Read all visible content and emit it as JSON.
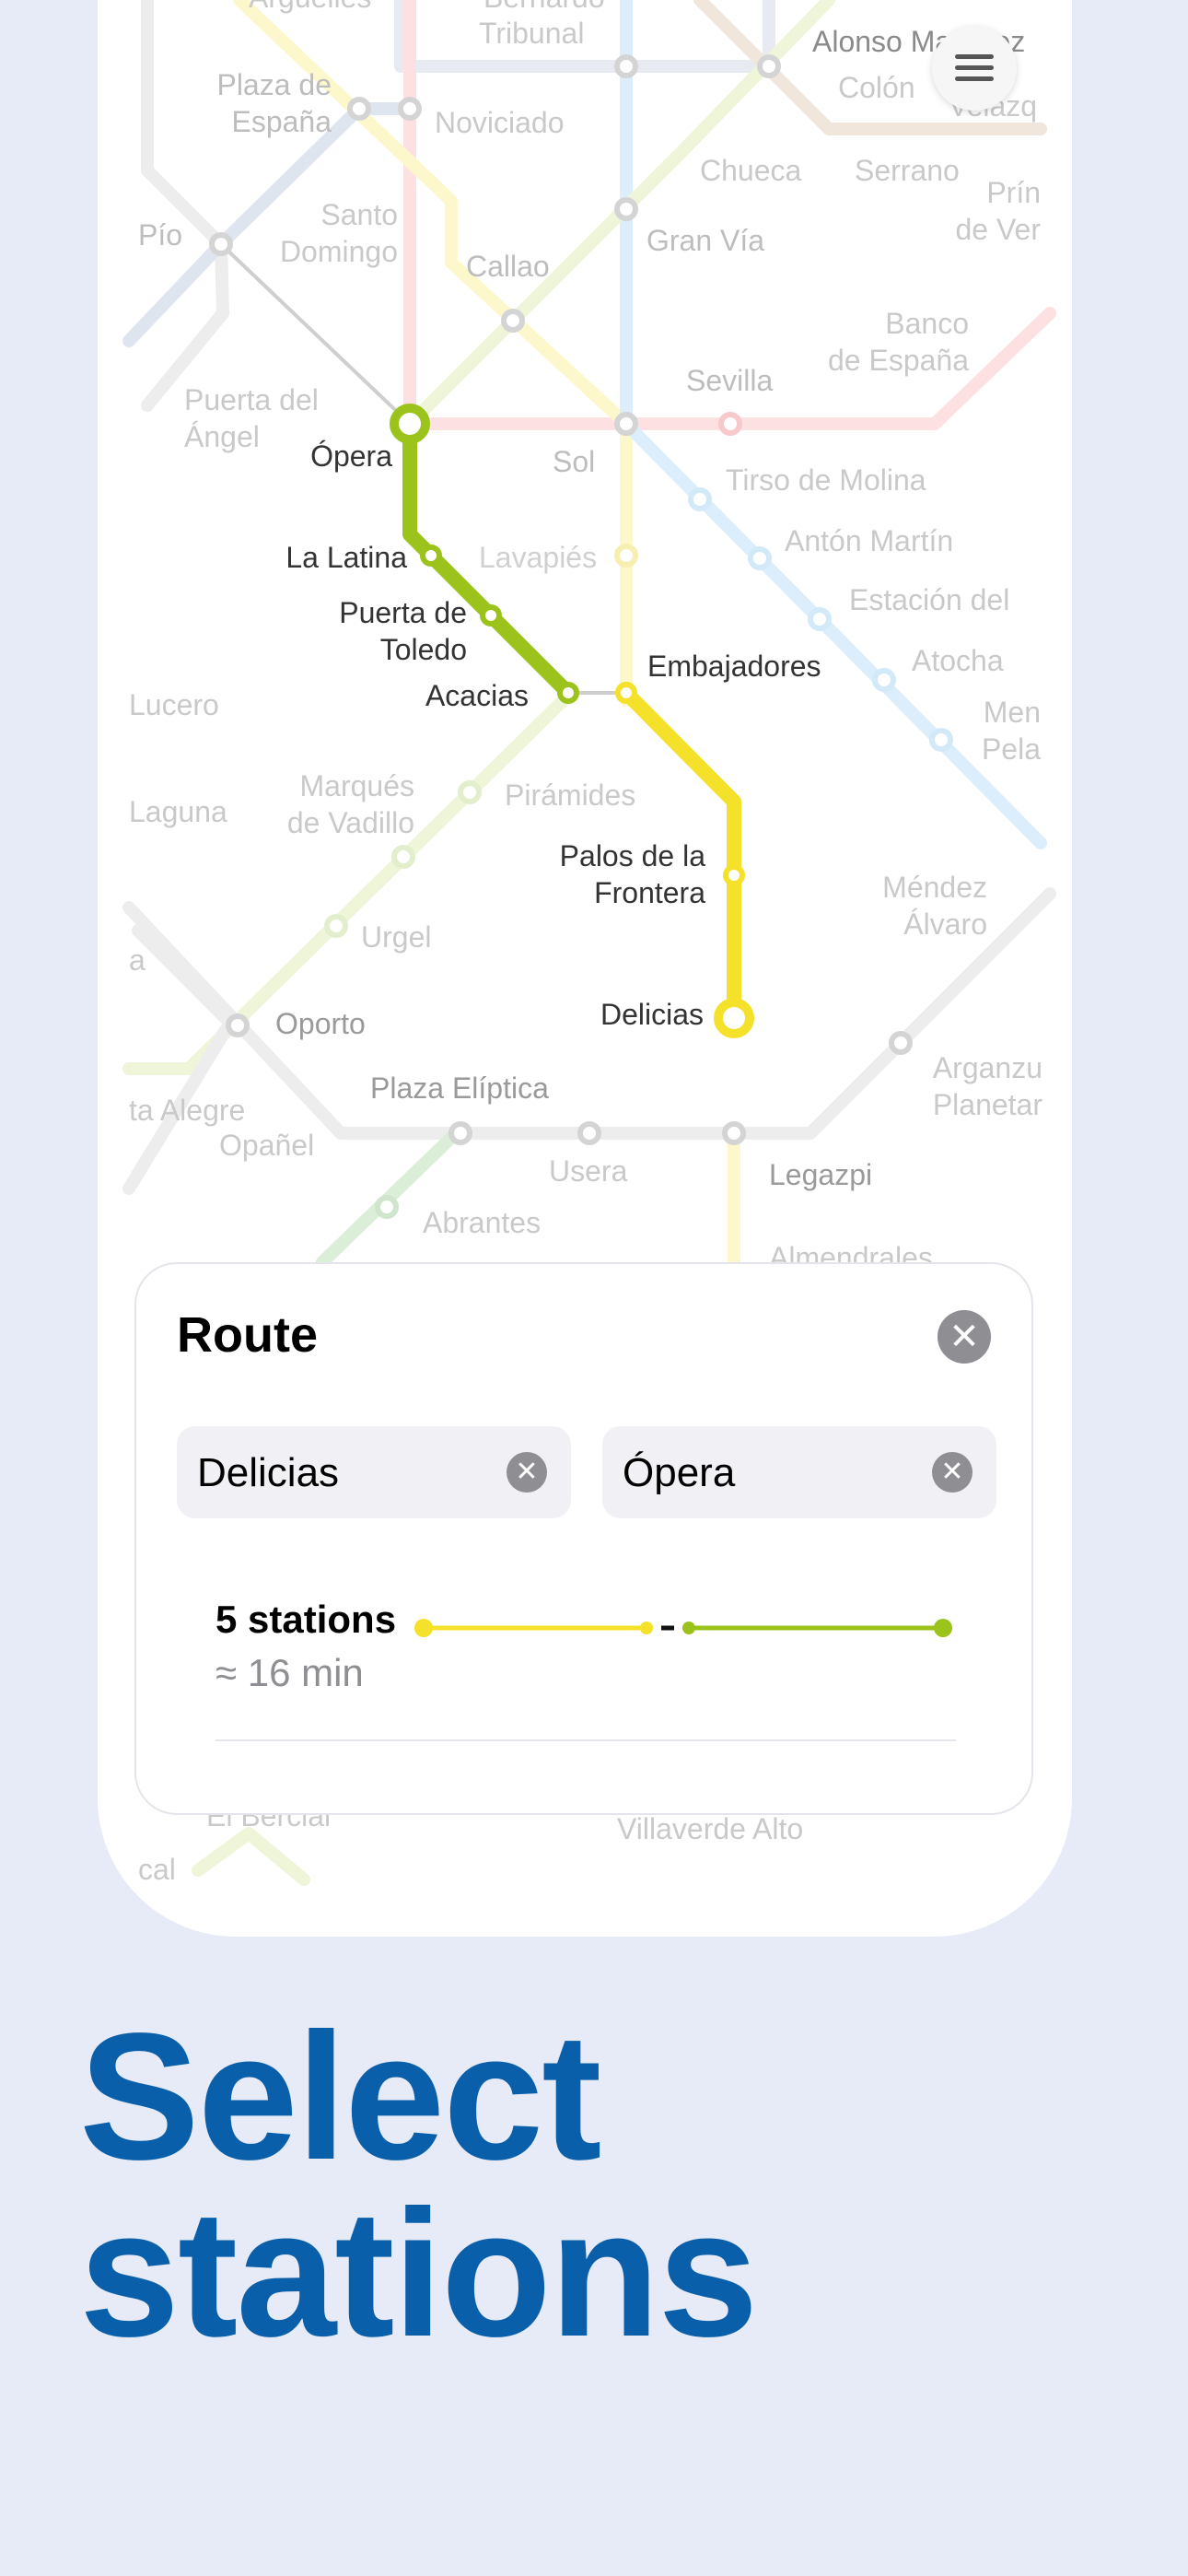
{
  "map": {
    "stations": {
      "arguelles_partial": "Argüelles",
      "san_bernardo": "Bernardo",
      "tribunal": "Tribunal",
      "alonso_martinez": "Alonso Martínez",
      "plaza_espana": "Plaza de\nEspaña",
      "noviciado": "Noviciado",
      "colon": "Colón",
      "velazquez": "Velázq",
      "chueca": "Chueca",
      "serrano": "Serrano",
      "principe_vergara": "Prín\nde Ver",
      "pio": "Pío",
      "santo_domingo": "Santo\nDomingo",
      "callao": "Callao",
      "gran_via": "Gran Vía",
      "banco_espana": "Banco\nde España",
      "puerta_angel": "Puerta del\nÁngel",
      "sevilla": "Sevilla",
      "opera": "Ópera",
      "sol": "Sol",
      "tirso_molina": "Tirso de Molina",
      "la_latina": "La Latina",
      "lavapies": "Lavapiés",
      "anton_martin": "Antón Martín",
      "puerta_toledo": "Puerta de\nToledo",
      "estacion_arte": "Estación del",
      "embajadores": "Embajadores",
      "acacias": "Acacias",
      "atocha": "Atocha",
      "lucero": "Lucero",
      "menendez_pelayo": "Men\nPela",
      "marques_vadillo": "Marqués\nde Vadillo",
      "piramides": "Pirámides",
      "laguna": "Laguna",
      "palos_frontera": "Palos de la\nFrontera",
      "mendez_alvaro": "Méndez\nÁlvaro",
      "urgel": "Urgel",
      "oporto": "Oporto",
      "delicias": "Delicias",
      "arganzuela": "Arganzu\nPlanetar",
      "vista_alegre": "ta Alegre",
      "opanel": "Opañel",
      "plaza_eliptica": "Plaza Elíptica",
      "usera": "Usera",
      "legazpi": "Legazpi",
      "abrantes": "Abrantes",
      "almendrales": "Almendrales",
      "el_bercial": "El Bercial",
      "villaverde_alto": "Villaverde Alto",
      "leftcut_a": "a",
      "leftcut_cal": "cal"
    }
  },
  "menu_button_icon": "hamburger-icon",
  "route_panel": {
    "title": "Route",
    "close_icon": "close-icon",
    "from": {
      "value": "Delicias",
      "clear_icon": "clear-icon"
    },
    "to": {
      "value": "Ópera",
      "clear_icon": "clear-icon"
    },
    "summary": {
      "stations": "5 stations",
      "duration": "≈ 16 min",
      "segments": [
        {
          "line_color": "#f5e02a",
          "stops": 3
        },
        {
          "line_color": "#9bc31c",
          "stops": 3
        }
      ]
    }
  },
  "headline": "Select stations",
  "colors": {
    "line_green": "#9bc31c",
    "line_yellow": "#f5e02a",
    "headline": "#0a5fab",
    "background": "#e6ebf7"
  }
}
